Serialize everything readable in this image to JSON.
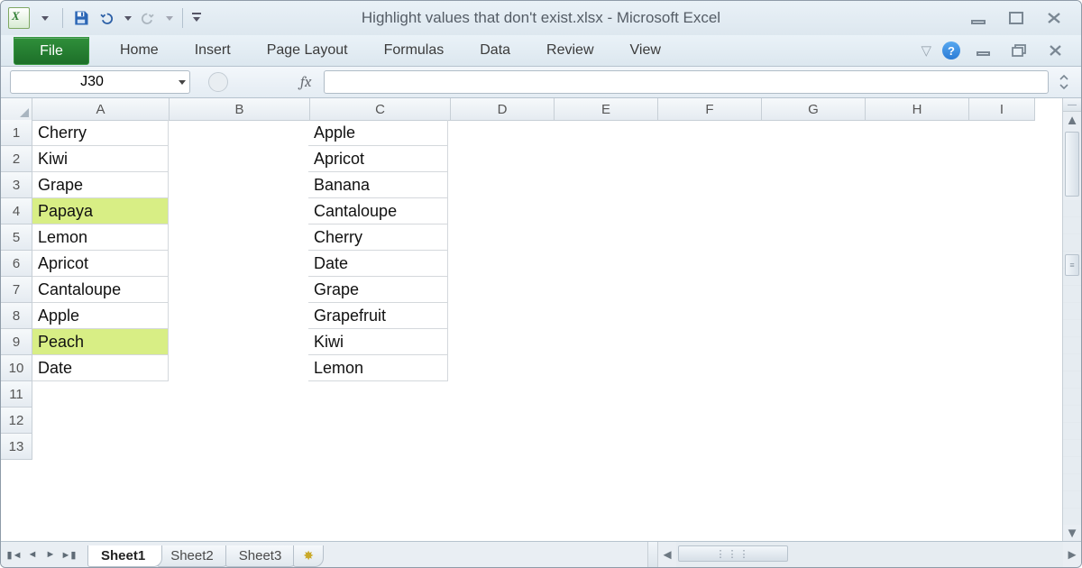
{
  "title": "Highlight values that don't exist.xlsx  -  Microsoft Excel",
  "ribbon": {
    "file": "File",
    "tabs": [
      "Home",
      "Insert",
      "Page Layout",
      "Formulas",
      "Data",
      "Review",
      "View"
    ]
  },
  "namebox": "J30",
  "fx_symbol": "fx",
  "formula": "",
  "columns": [
    "A",
    "B",
    "C",
    "D",
    "E",
    "F",
    "G",
    "H",
    "I"
  ],
  "row_headers": [
    "1",
    "2",
    "3",
    "4",
    "5",
    "6",
    "7",
    "8",
    "9",
    "10",
    "11",
    "12",
    "13"
  ],
  "cells": {
    "A": [
      "Cherry",
      "Kiwi",
      "Grape",
      "Papaya",
      "Lemon",
      "Apricot",
      "Cantaloupe",
      "Apple",
      "Peach",
      "Date"
    ],
    "C": [
      "Apple",
      "Apricot",
      "Banana",
      "Cantaloupe",
      "Cherry",
      "Date",
      "Grape",
      "Grapefruit",
      "Kiwi",
      "Lemon"
    ]
  },
  "highlight_rows_A": [
    4,
    9
  ],
  "highlight_color": "#d8ee85",
  "sheets": {
    "items": [
      "Sheet1",
      "Sheet2",
      "Sheet3"
    ],
    "active": "Sheet1"
  }
}
